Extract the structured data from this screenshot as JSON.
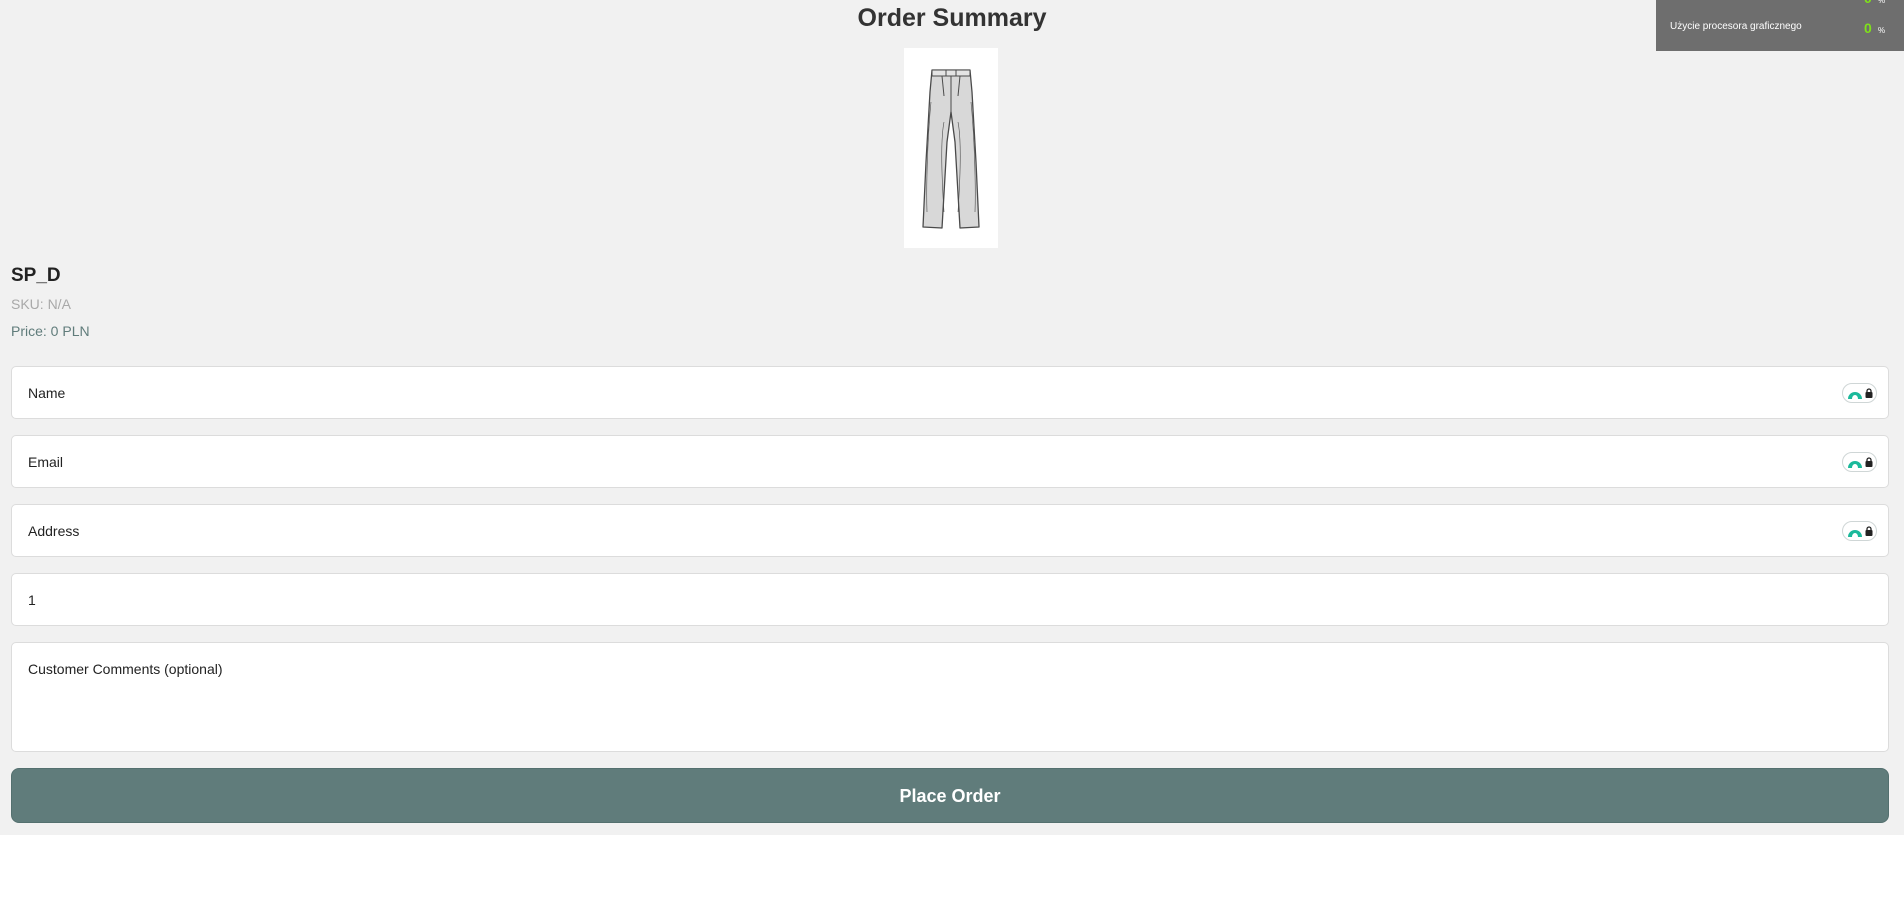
{
  "page": {
    "title": "Order Summary"
  },
  "product": {
    "name": "SP_D",
    "sku": "SKU: N/A",
    "price": "Price: 0 PLN",
    "image_icon": "trousers-sketch-icon"
  },
  "form": {
    "name_value": "Name",
    "email_value": "Email",
    "address_value": "Address",
    "quantity_value": "1",
    "comments_value": "Customer Comments (optional)",
    "password_manager_icon": "password-manager-lock-icon",
    "submit_label": "Place Order"
  },
  "overlay": {
    "gpu_label": "Użycie procesora graficznego",
    "gpu_value": "0",
    "gpu_unit": "%",
    "top_value": "0",
    "top_unit": "%"
  },
  "colors": {
    "accent": "#607c7b",
    "background": "#f1f1f1",
    "overlay_bg": "#6e6e6e",
    "overlay_value": "#7fe01a",
    "badge_teal": "#1cb99b"
  }
}
